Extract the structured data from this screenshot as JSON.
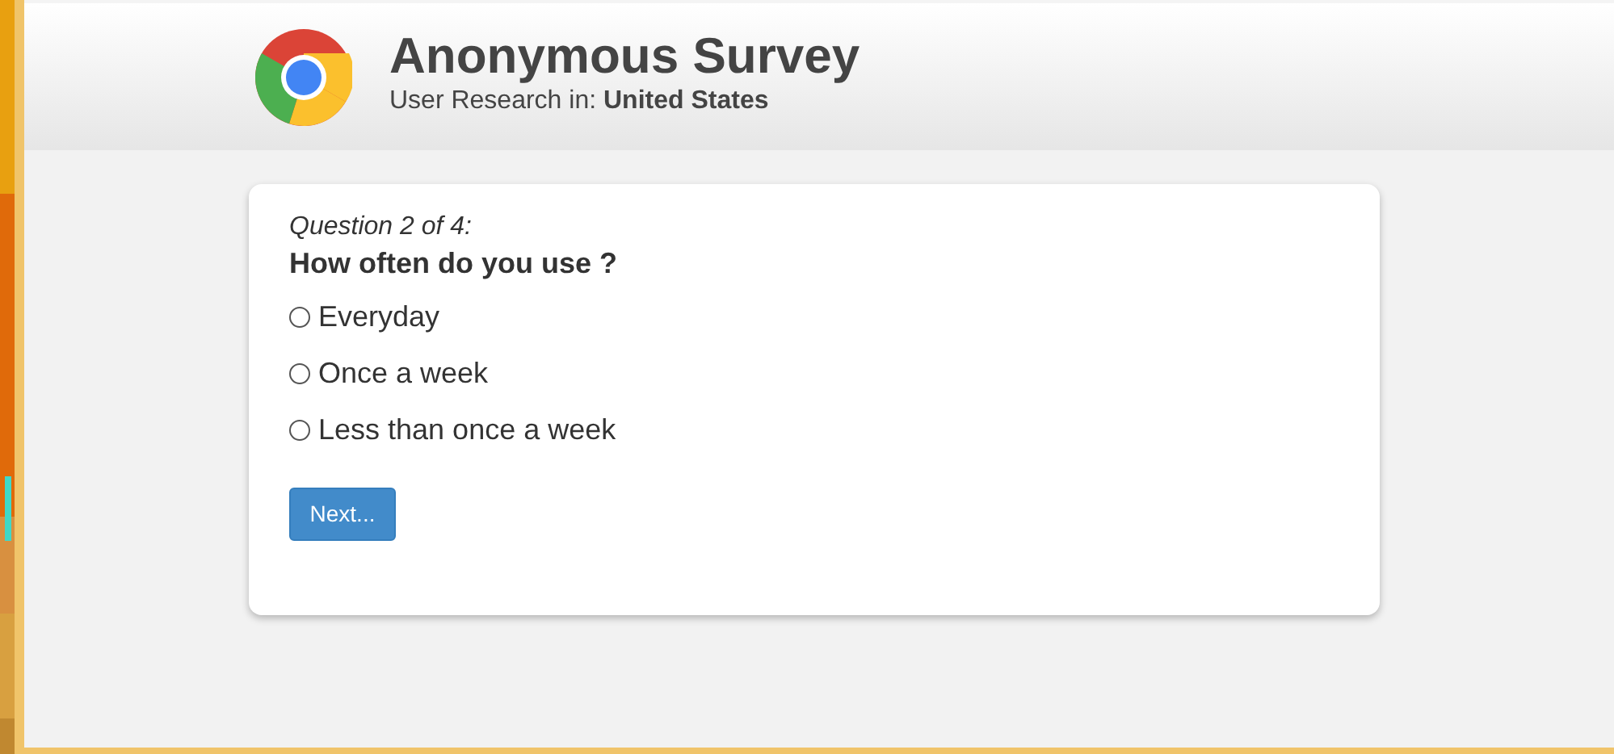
{
  "header": {
    "title": "Anonymous Survey",
    "subtitle": "User Research in: **United States**"
  },
  "question": {
    "counter": "Question 2 of 4:",
    "text": "How often do you use ?",
    "options": [
      {
        "label": "Everyday",
        "selected": false
      },
      {
        "label": "Once a week",
        "selected": false
      },
      {
        "label": "Less than once a week",
        "selected": false
      }
    ],
    "button": "Next..."
  }
}
